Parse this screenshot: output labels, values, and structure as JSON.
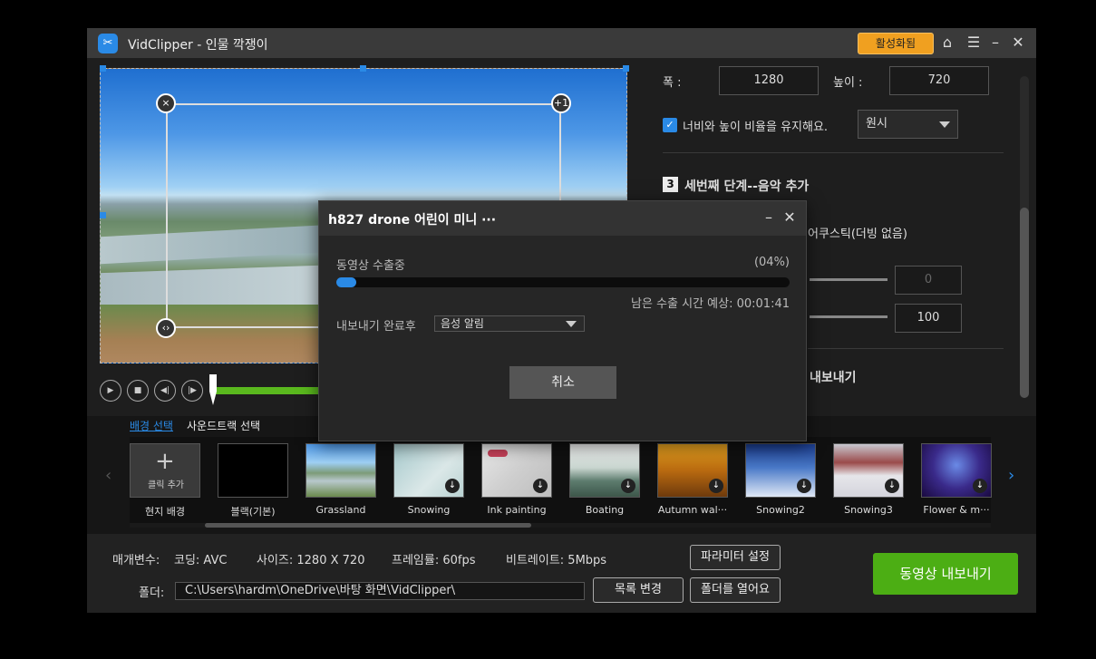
{
  "app": {
    "title": "VidClipper - 인물 깍쟁이",
    "activate_label": "활성화됨"
  },
  "preview": {
    "crop_close": "×",
    "crop_plus": "+1",
    "crop_flip": "‹›"
  },
  "right_panel": {
    "width_label": "폭 :",
    "width_value": "1280",
    "height_label": "높이 :",
    "height_value": "720",
    "keep_ratio_label": "너비와 높이 비율을 유지해요.",
    "ratio_select": "원시",
    "step3_num": "3",
    "step3_title": "세번째 단계--음악 추가",
    "music_option": "어쿠스틱(더빙 없음)",
    "slider1_value": "0",
    "slider2_value": "100",
    "export_title": "내보내기"
  },
  "bg_strip": {
    "tab_bg": "배경 선택",
    "tab_soundtrack": "사운드트랙 선택",
    "add_label": "클릭 추가",
    "items": [
      {
        "caption": "현지 배경"
      },
      {
        "caption": "블랙(기본)"
      },
      {
        "caption": "Grassland"
      },
      {
        "caption": "Snowing"
      },
      {
        "caption": "Ink painting"
      },
      {
        "caption": "Boating"
      },
      {
        "caption": "Autumn wal···"
      },
      {
        "caption": "Snowing2"
      },
      {
        "caption": "Snowing3"
      },
      {
        "caption": "Flower & m···"
      }
    ]
  },
  "footer": {
    "params_label": "매개변수:",
    "codec": "코딩: AVC",
    "size": "사이즈: 1280 X 720",
    "framerate": "프레임률: 60fps",
    "bitrate": "비트레이트: 5Mbps",
    "param_btn": "파라미터 설정",
    "folder_label": "폴더:",
    "folder_path": "C:\\Users\\hardm\\OneDrive\\바탕 화면\\VidClipper\\",
    "change_btn": "목록 변경",
    "open_btn": "폴더를 열어요",
    "export_btn": "동영상 내보내기"
  },
  "dialog": {
    "title": "h827 drone 어린이 미니 ···",
    "status": "동영상 수출중",
    "percent_text": "(04%)",
    "progress": 0.04,
    "remaining": "남은 수출 시간 예상: 00:01:41",
    "after_label": "내보내기 완료후",
    "after_select": "음성 알림",
    "cancel_btn": "취소"
  },
  "colors": {
    "accent": "#2a8ae6",
    "export_green": "#4cae14",
    "activate_orange": "#f0a020"
  }
}
